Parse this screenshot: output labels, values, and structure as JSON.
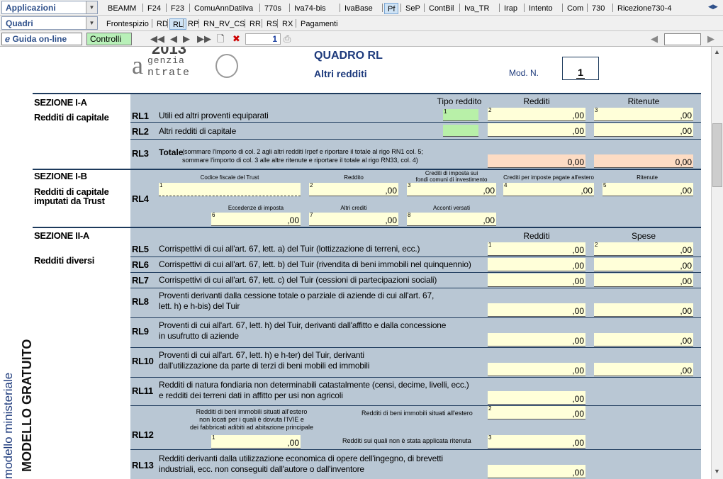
{
  "toolbar": {
    "applications_combo": "Applicazioni",
    "frames_combo": "Quadri",
    "tabs_row1": [
      "BEAMM",
      "F24",
      "F23",
      "ComuAnnDatiIva",
      "770s",
      "Iva74-bis",
      "IvaBase",
      "Pf",
      "SeP",
      "ContBil",
      "Iva_TR",
      "Irap",
      "Intento",
      "Com",
      "730",
      "Ricezione730-4"
    ],
    "active_tab_row1": "Pf",
    "tabs_row2": [
      "Frontespizio",
      "RD",
      "RL",
      "RP",
      "RN_RV_CS",
      "RR",
      "RS",
      "RX",
      "Pagamenti"
    ],
    "active_tab_row2": "RL",
    "guide_button": "Guida on-line",
    "controls_button": "Controlli",
    "page_number": "1",
    "right_field": ""
  },
  "header": {
    "year_partial": "2013",
    "logo_line1": "genzia",
    "logo_line2": "ntrate",
    "quadro_title": "QUADRO RL",
    "quadro_subtitle": "Altri redditi",
    "mod_label": "Mod. N.",
    "mod_value": "1"
  },
  "side": {
    "line1": "modello ministeriale",
    "line2": "MODELLO GRATUITO"
  },
  "sec_ia": {
    "title": "SEZIONE I-A",
    "subtitle": "Redditi di capitale",
    "col_tipo": "Tipo reddito",
    "col_redditi": "Redditi",
    "col_ritenute": "Ritenute",
    "rl1_code": "RL1",
    "rl1_desc": "Utili ed altri proventi equiparati",
    "rl2_code": "RL2",
    "rl2_desc": "Altri redditi di capitale",
    "rl3_code": "RL3",
    "rl3_bold": "Totale",
    "rl3_desc1": "(sommare l'importo di col. 2 agli altri redditi Irpef e riportare il totale al rigo RN1 col. 5;",
    "rl3_desc2": "sommare l'importo di col. 3 alle altre ritenute e riportare il totale al rigo RN33, col. 4)",
    "rl3_val1": "0",
    "rl3_val2": "0"
  },
  "sec_ib": {
    "title": "SEZIONE I-B",
    "subtitle1": "Redditi di capitale",
    "subtitle2": "imputati da Trust",
    "rl4_code": "RL4",
    "h_codice": "Codice fiscale del Trust",
    "h_reddito": "Reddito",
    "h_crediti1": "Crediti di imposta sui",
    "h_crediti2": "fondi comuni di investimento",
    "h_estero": "Crediti per imposte pagate all'estero",
    "h_ritenute": "Ritenute",
    "h_eccedenze": "Eccedenze di imposta",
    "h_altri": "Altri crediti",
    "h_acconti": "Acconti versati"
  },
  "sec_iia": {
    "title": "SEZIONE II-A",
    "subtitle": "Redditi diversi",
    "col_redditi": "Redditi",
    "col_spese": "Spese",
    "rows": [
      {
        "code": "RL5",
        "d1": "Corrispettivi di cui all'art. 67, lett. a) del Tuir (lottizzazione di terreni, ecc.)",
        "d2": ""
      },
      {
        "code": "RL6",
        "d1": "Corrispettivi di cui all'art. 67, lett. b) del Tuir (rivendita di beni immobili nel quinquennio)",
        "d2": ""
      },
      {
        "code": "RL7",
        "d1": "Corrispettivi di cui all'art. 67, lett. c) del Tuir (cessioni di partecipazioni sociali)",
        "d2": ""
      },
      {
        "code": "RL8",
        "d1": "Proventi derivanti dalla cessione totale o parziale di aziende di cui all'art. 67,",
        "d2": "lett. h) e h-bis) del Tuir"
      },
      {
        "code": "RL9",
        "d1": "Proventi di cui all'art. 67, lett. h) del Tuir, derivanti dall'affitto e dalla concessione",
        "d2": "in usufrutto di aziende"
      },
      {
        "code": "RL10",
        "d1": "Proventi di cui all'art. 67, lett. h) e h-ter) del Tuir, derivanti",
        "d2": "dall'utilizzazione da parte di terzi di beni mobili ed immobili"
      },
      {
        "code": "RL11",
        "d1": "Redditi di natura fondiaria non determinabili catastalmente (censi, decime, livelli, ecc.)",
        "d2": "e redditi dei terreni dati in affitto per usi non agricoli"
      }
    ],
    "rl12_code": "RL12",
    "rl12_left1": "Redditi di beni immobili situati all'estero",
    "rl12_left2": "non locati per i quali è dovuta l'IVIE e",
    "rl12_left3": "dei fabbricati adibiti ad abitazione principale",
    "rl12_right1": "Redditi di beni immobili situati all'estero",
    "rl12_right2": "Redditi sui quali non è stata applicata ritenuta",
    "rl13_code": "RL13",
    "rl13_d1": "Redditi derivanti dalla utilizzazione economica di opere dell'ingegno, di brevetti",
    "rl13_d2": "industriali, ecc. non conseguiti dall'autore o dall'inventore"
  },
  "decimals": ",00",
  "colors": {
    "form_bg": "#b9c7d4",
    "field": "#ffffd9",
    "green": "#b8f0a8",
    "peach": "#fddcc4",
    "line": "#1d3a5c"
  }
}
